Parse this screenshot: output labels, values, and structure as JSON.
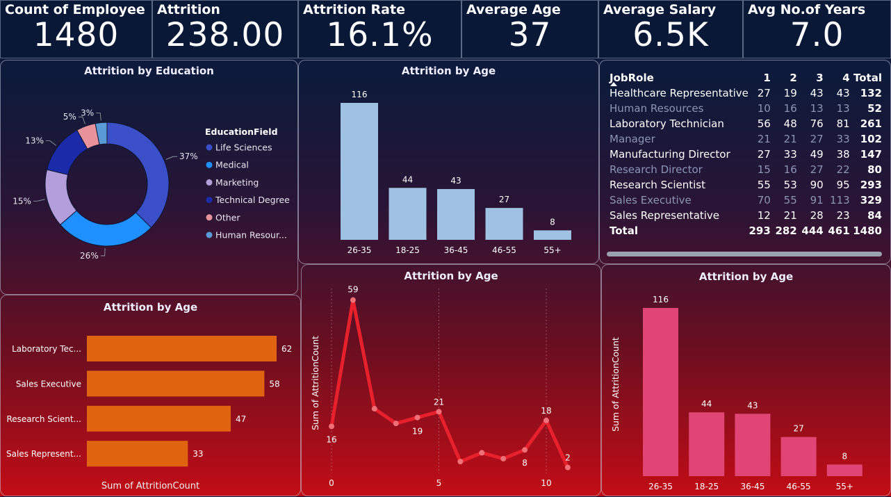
{
  "kpis": [
    {
      "label": "Count of Employee",
      "value": "1480"
    },
    {
      "label": "Attrition",
      "value": "238.00"
    },
    {
      "label": "Attrition Rate",
      "value": "16.1%"
    },
    {
      "label": "Average Age",
      "value": "37"
    },
    {
      "label": "Average Salary",
      "value": "6.5K"
    },
    {
      "label": "Avg No.of Years",
      "value": "7.0"
    }
  ],
  "education_chart": {
    "title": "Attrition by Education",
    "legend_title": "EducationField",
    "chart_data": {
      "type": "pie",
      "categories": [
        "Life Sciences",
        "Medical",
        "Marketing",
        "Technical Degree",
        "Other",
        "Human Resour..."
      ],
      "values": [
        37,
        26,
        15,
        13,
        5,
        3
      ],
      "labels": [
        "37%",
        "26%",
        "15%",
        "13%",
        "5%",
        "3%"
      ],
      "colors": [
        "#3b4fc8",
        "#1e90ff",
        "#b39ddb",
        "#1a2aa8",
        "#e8929b",
        "#5b9bd5"
      ],
      "legend_position": "right"
    }
  },
  "age_bar_top": {
    "title": "Attrition by Age",
    "chart_data": {
      "type": "bar",
      "categories": [
        "26-35",
        "18-25",
        "36-45",
        "46-55",
        "55+"
      ],
      "values": [
        116,
        44,
        43,
        27,
        8
      ],
      "color": "#9fc1e4"
    }
  },
  "jobrole_table": {
    "headers": [
      "JobRole",
      "1",
      "2",
      "3",
      "4",
      "Total"
    ],
    "rows": [
      {
        "role": "Healthcare Representative",
        "v1": "27",
        "v2": "19",
        "v3": "43",
        "v4": "43",
        "total": "132"
      },
      {
        "role": "Human Resources",
        "v1": "10",
        "v2": "16",
        "v3": "13",
        "v4": "13",
        "total": "52"
      },
      {
        "role": "Laboratory Technician",
        "v1": "56",
        "v2": "48",
        "v3": "76",
        "v4": "81",
        "total": "261"
      },
      {
        "role": "Manager",
        "v1": "21",
        "v2": "21",
        "v3": "27",
        "v4": "33",
        "total": "102"
      },
      {
        "role": "Manufacturing Director",
        "v1": "27",
        "v2": "33",
        "v3": "49",
        "v4": "38",
        "total": "147"
      },
      {
        "role": "Research Director",
        "v1": "15",
        "v2": "16",
        "v3": "27",
        "v4": "22",
        "total": "80"
      },
      {
        "role": "Research Scientist",
        "v1": "55",
        "v2": "53",
        "v3": "90",
        "v4": "95",
        "total": "293"
      },
      {
        "role": "Sales Executive",
        "v1": "70",
        "v2": "55",
        "v3": "91",
        "v4": "113",
        "total": "329"
      },
      {
        "role": "Sales Representative",
        "v1": "12",
        "v2": "21",
        "v3": "28",
        "v4": "23",
        "total": "84"
      }
    ],
    "totals": {
      "role": "Total",
      "v1": "293",
      "v2": "282",
      "v3": "444",
      "v4": "461",
      "total": "1480"
    }
  },
  "jobrole_bar": {
    "title": "Attrition by Age",
    "xlabel": "Sum of AttritionCount",
    "chart_data": {
      "type": "bar",
      "orientation": "horizontal",
      "categories": [
        "Laboratory Tec...",
        "Sales Executive",
        "Research Scient...",
        "Sales Represent..."
      ],
      "values": [
        62,
        58,
        47,
        33
      ],
      "color": "#e0640f"
    }
  },
  "age_line": {
    "title": "Attrition by Age",
    "ylabel": "Sum of AttritionCount",
    "chart_data": {
      "type": "line",
      "x": [
        0,
        1,
        2,
        3,
        4,
        5,
        6,
        7,
        8,
        9,
        10,
        11
      ],
      "y": [
        16,
        59,
        22,
        17,
        19,
        21,
        4,
        7,
        5,
        8,
        18,
        2
      ],
      "point_labels": {
        "0": "16",
        "1": "59",
        "4": "19",
        "5": "21",
        "9": "8",
        "10": "18",
        "11": "2"
      },
      "xticks": [
        0,
        5,
        10
      ],
      "ylim": [
        0,
        62
      ],
      "color": "#e8202c"
    }
  },
  "age_bar_pink": {
    "title": "Attrition by Age",
    "ylabel": "Sum of AttritionCount",
    "chart_data": {
      "type": "bar",
      "categories": [
        "26-35",
        "18-25",
        "36-45",
        "46-55",
        "55+"
      ],
      "values": [
        116,
        44,
        43,
        27,
        8
      ],
      "color": "#e04575"
    }
  }
}
